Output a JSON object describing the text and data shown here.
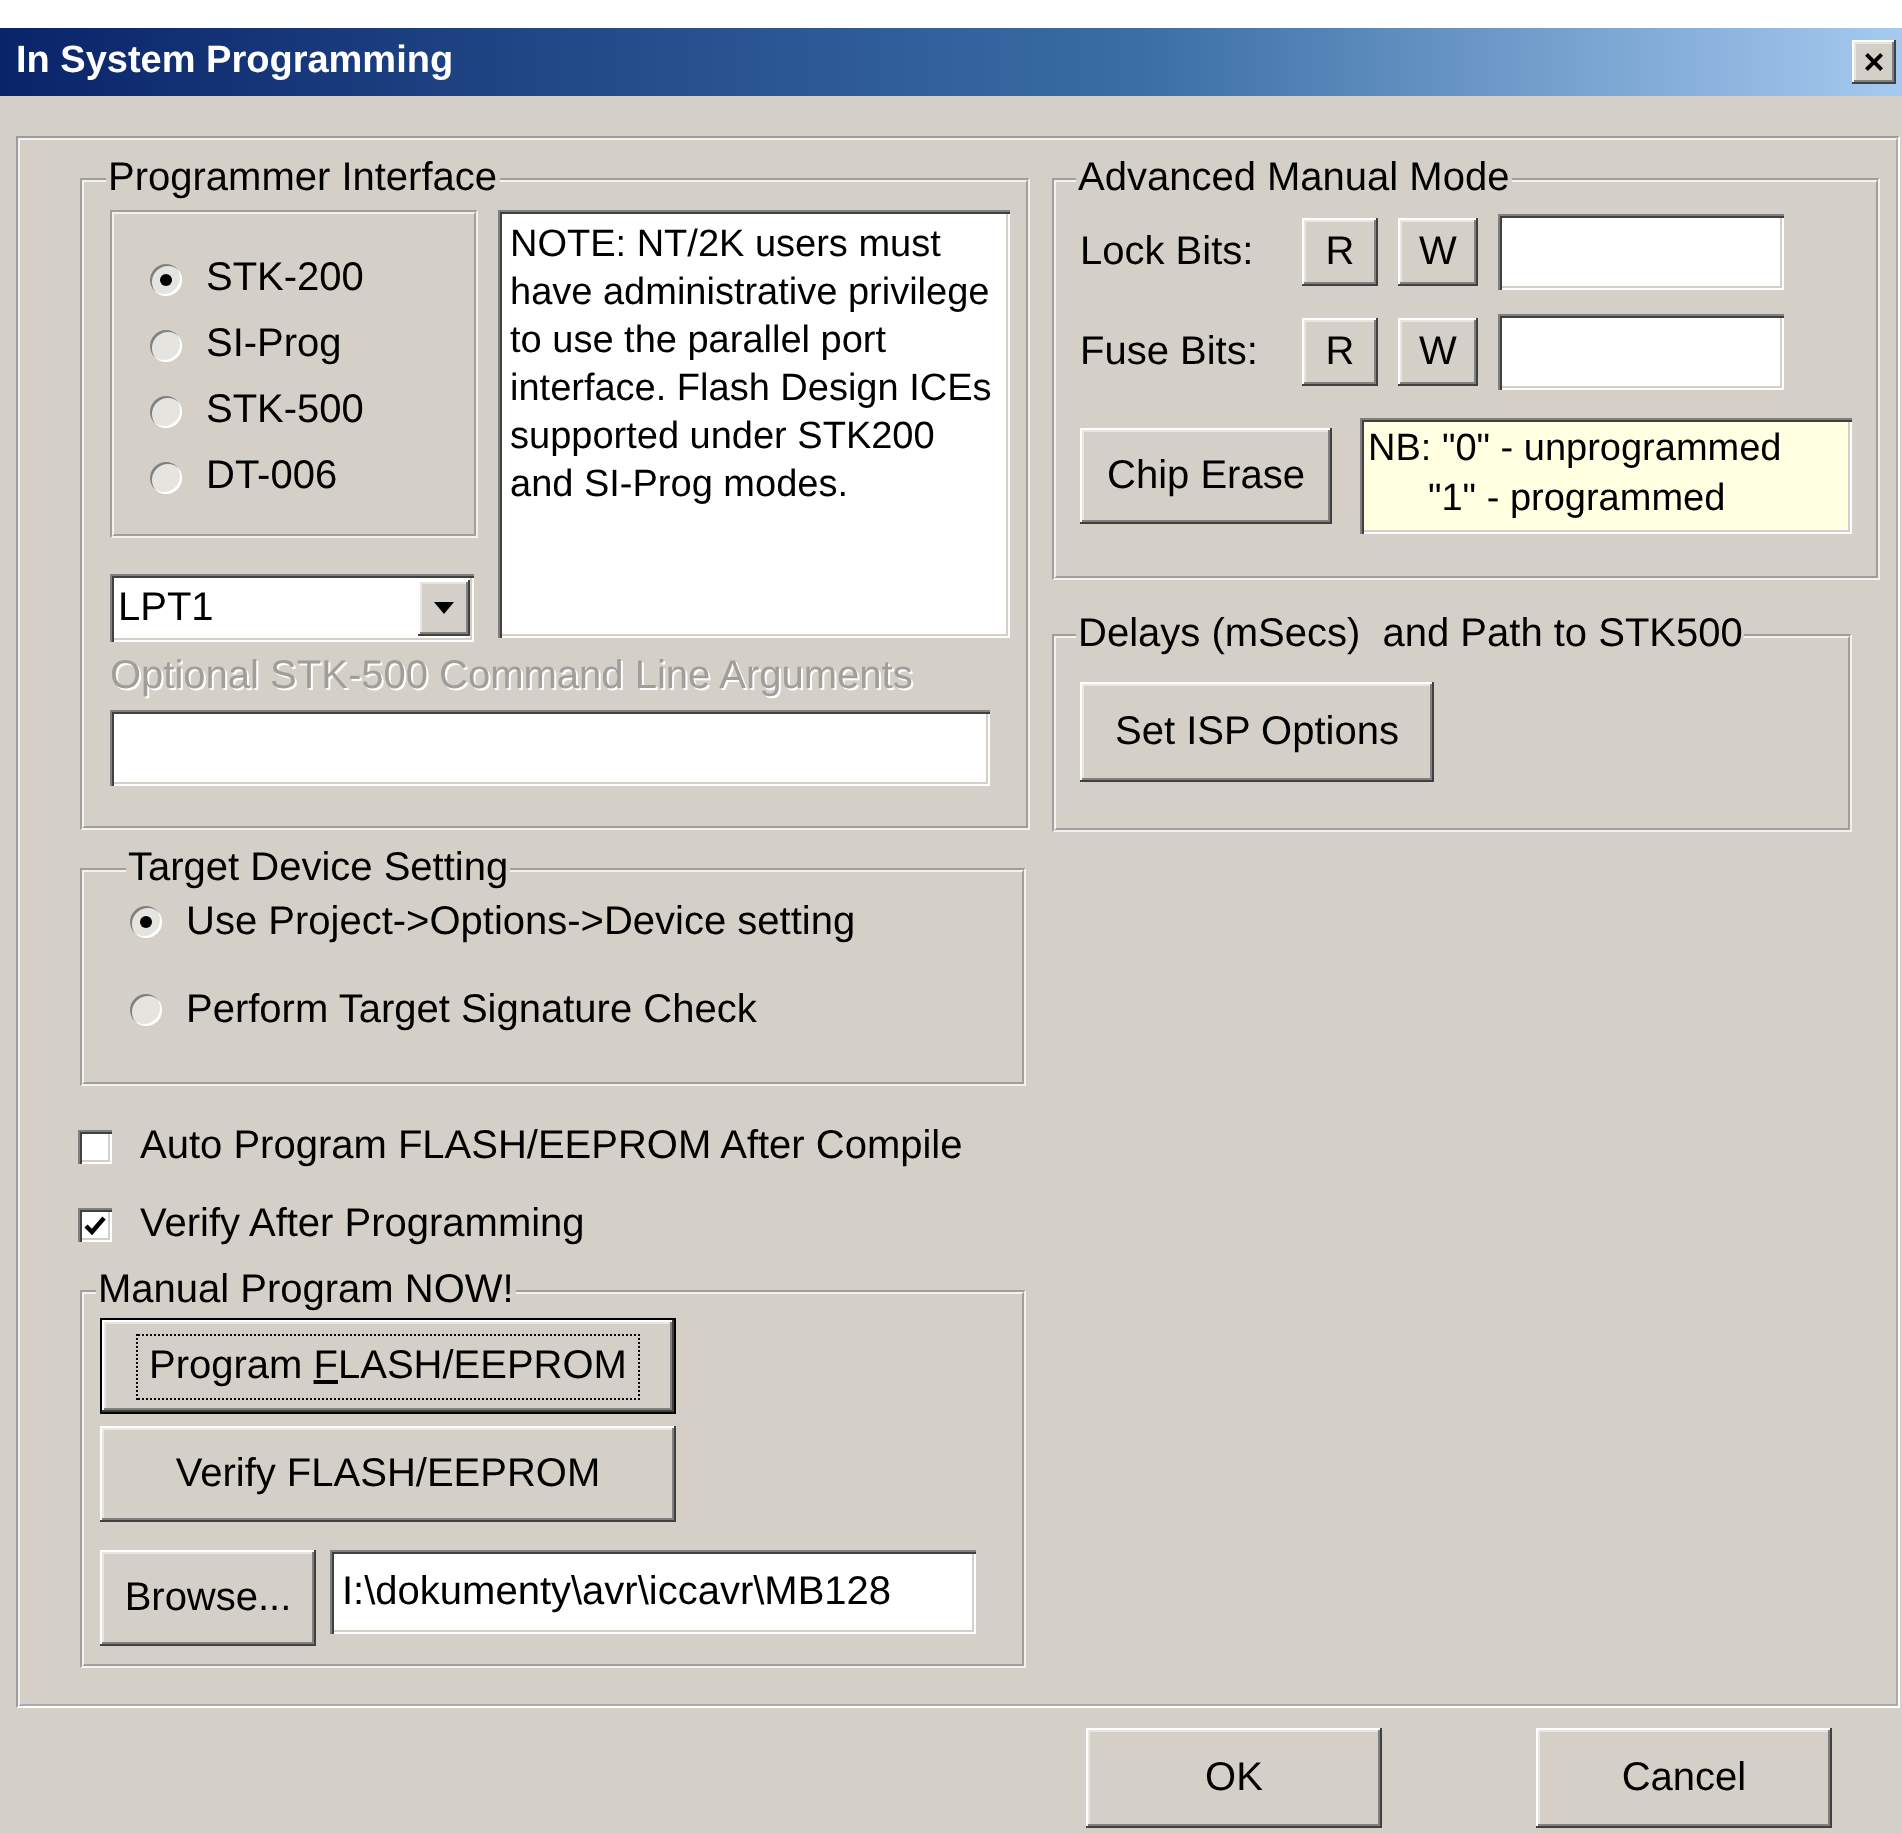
{
  "window": {
    "title": "In System Programming",
    "close": "×"
  },
  "programmer_interface": {
    "title": "Programmer Interface",
    "options": [
      {
        "label": "STK-200",
        "selected": true
      },
      {
        "label": "SI-Prog",
        "selected": false
      },
      {
        "label": "STK-500",
        "selected": false
      },
      {
        "label": "DT-006",
        "selected": false
      }
    ],
    "note": "NOTE: NT/2K users must have administrative privilege to use the parallel port interface. Flash Design ICEs supported under STK200 and SI-Prog modes.",
    "port": {
      "value": "LPT1"
    },
    "arguments": {
      "label": "Optional STK-500 Command Line Arguments",
      "disabled": true
    }
  },
  "target_device": {
    "title": "Target Device Setting",
    "options": [
      {
        "label": "Use Project->Options->Device setting",
        "selected": true
      },
      {
        "label": "Perform Target Signature Check",
        "selected": false
      }
    ]
  },
  "checkboxes": [
    {
      "label": "Auto Program FLASH/EEPROM After Compile",
      "checked": false
    },
    {
      "label": "Verify After Programming",
      "checked": true
    }
  ],
  "manual_program": {
    "title": "Manual Program NOW!",
    "program_button": {
      "text_before": "Program ",
      "access_key": "F",
      "text_after": "LASH/EEPROM",
      "focused": true
    },
    "verify_button": {
      "label": "Verify FLASH/EEPROM",
      "focused": false
    },
    "browse_button": "Browse...",
    "path": "I:\\dokumenty\\avr\\iccavr\\MB128"
  },
  "advanced_manual_mode": {
    "title": "Advanced Manual Mode",
    "rows": [
      {
        "label": "Lock Bits:",
        "read": "R",
        "write": "W"
      },
      {
        "label": "Fuse Bits:",
        "read": "R",
        "write": "W"
      }
    ],
    "chip_erase": "Chip Erase",
    "note": [
      "NB: \"0\" - unprogrammed",
      "\"1\" - programmed"
    ]
  },
  "delays": {
    "title": "Delays (mSecs)  and Path to STK500",
    "button": "Set ISP Options"
  },
  "buttons": [
    {
      "label": "OK"
    },
    {
      "label": "Cancel"
    }
  ]
}
